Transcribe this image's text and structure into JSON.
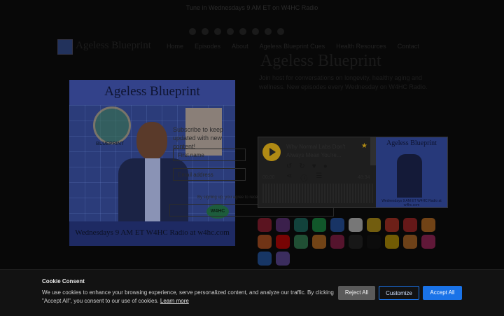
{
  "announcement": "Tune in Wednesdays 9 AM ET on W4HC Radio",
  "site": {
    "brand": "Ageless Blueprint"
  },
  "nav": {
    "items": [
      "Home",
      "Episodes",
      "About",
      "Ageless Blueprint Cues",
      "Health Resources",
      "Contact"
    ]
  },
  "page": {
    "heading": "Ageless Blueprint",
    "paragraph": "Join host for conversations on longevity, healthy aging and wellness. New episodes every Wednesday on W4HC Radio."
  },
  "cover": {
    "title": "Ageless Blueprint",
    "seal_text": "BLUEPRINT",
    "station": "W4HC",
    "footer": "Wednesdays 9 AM ET W4HC Radio at w4hc.com"
  },
  "subscribe": {
    "text": "Subscribe to keep updated with new content!",
    "first_name_placeholder": "First name",
    "email_placeholder": "Email address",
    "consent": "By signing up, you agree to receive email from this podcast."
  },
  "player": {
    "episode_title": "Why Normal Labs Don't Always Mean You're...",
    "time_current": "00:00",
    "time_total": "48:34",
    "art_title": "Ageless Blueprint",
    "art_footer": "Wednesdays 9 AM ET W4HC Radio at w4hc.com",
    "icons": [
      "replay-icon",
      "forward-icon",
      "heart-icon",
      "comment-icon",
      "share-icon",
      "info-icon",
      "transcript-icon"
    ]
  },
  "platforms": {
    "colors": [
      "#c0243e",
      "#7b3fa0",
      "#1f8a7a",
      "#1db954",
      "#2c6bd6",
      "#ffffff",
      "#f5c518",
      "#e83e2d",
      "#d62c2c",
      "#f28c28",
      "#f06a27",
      "#ff0000",
      "#3fa66b",
      "#f28c28",
      "#b3245a",
      "#2b2b2b",
      "#111111",
      "#f2c200",
      "#e8882d",
      "#cc2d73",
      "#2a6fd6",
      "#7a5cc7"
    ]
  },
  "cookie": {
    "title": "Cookie Consent",
    "text": "We use cookies to enhance your browsing experience, serve personalized content, and analyze our traffic. By clicking \"Accept All\", you consent to our use of cookies.",
    "link": "Learn more",
    "reject": "Reject All",
    "customize": "Customize",
    "accept": "Accept All"
  }
}
